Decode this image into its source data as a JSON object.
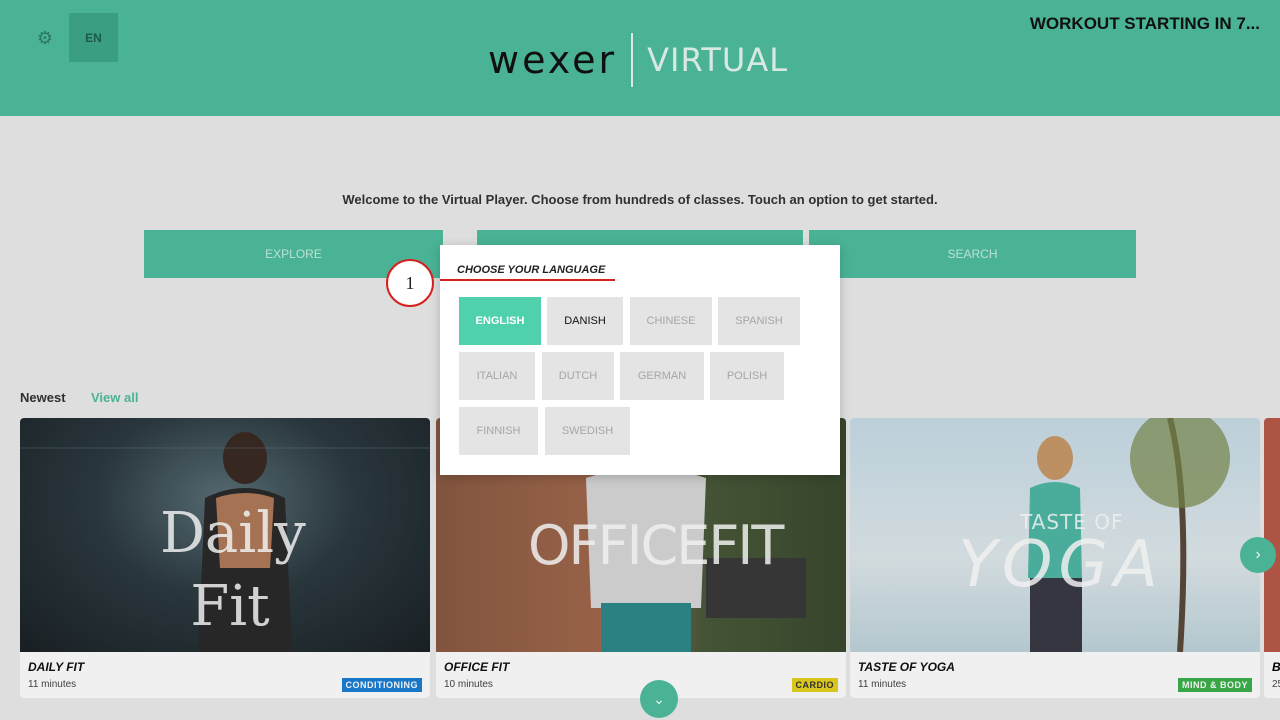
{
  "header": {
    "lang_code": "EN",
    "logo_brand": "wexer",
    "logo_product": "VIRTUAL",
    "countdown": "WORKOUT STARTING IN 7..."
  },
  "welcome_text": "Welcome to the Virtual Player. Choose from hundreds of classes. Touch an option to get started.",
  "nav": {
    "explore": "EXPLORE",
    "search": "SEARCH"
  },
  "section": {
    "title": "Newest",
    "view_all": "View all"
  },
  "cards": [
    {
      "title": "DAILY FIT",
      "duration": "11 minutes",
      "badge": "CONDITIONING",
      "badge_bg": "#1a7fd6",
      "badge_fg": "#ffffff",
      "art": "Daily Fit"
    },
    {
      "title": "OFFICE FIT",
      "duration": "10 minutes",
      "badge": "CARDIO",
      "badge_bg": "#e6d21f",
      "badge_fg": "#333333",
      "art": "OFFICEFIT"
    },
    {
      "title": "TASTE OF YOGA",
      "duration": "11 minutes",
      "badge": "MIND & BODY",
      "badge_bg": "#3bb24a",
      "badge_fg": "#ffffff",
      "art_top": "TASTE OF",
      "art_main": "YOGA"
    }
  ],
  "partial_card": {
    "title": "B",
    "duration": "25"
  },
  "modal": {
    "title": "CHOOSE YOUR LANGUAGE",
    "languages": [
      {
        "label": "ENGLISH",
        "state": "active"
      },
      {
        "label": "DANISH",
        "state": "normal"
      },
      {
        "label": "CHINESE",
        "state": "disabled"
      },
      {
        "label": "SPANISH",
        "state": "disabled"
      },
      {
        "label": "ITALIAN",
        "state": "disabled"
      },
      {
        "label": "DUTCH",
        "state": "disabled"
      },
      {
        "label": "GERMAN",
        "state": "disabled"
      },
      {
        "label": "POLISH",
        "state": "disabled"
      },
      {
        "label": "FINNISH",
        "state": "disabled"
      },
      {
        "label": "SWEDISH",
        "state": "disabled"
      }
    ]
  },
  "callout": {
    "number": "1",
    "color": "#d61f1f"
  },
  "colors": {
    "accent": "#4fbf9f",
    "active_chip": "#4fd1ae"
  }
}
